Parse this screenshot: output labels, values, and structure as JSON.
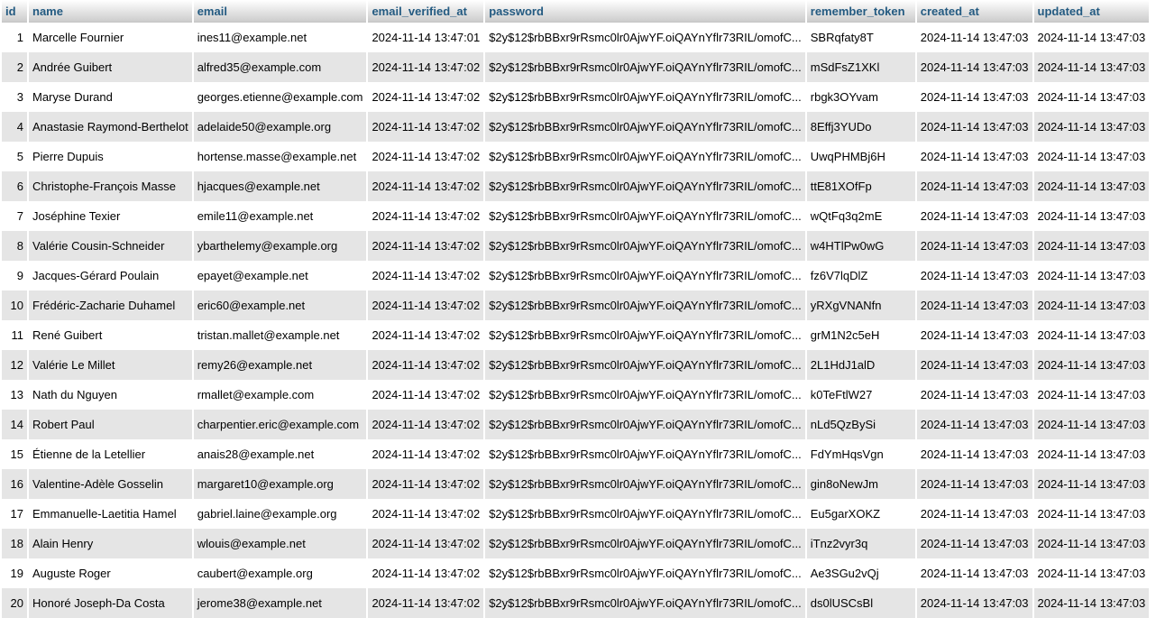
{
  "columns": [
    "id",
    "name",
    "email",
    "email_verified_at",
    "password",
    "remember_token",
    "created_at",
    "updated_at"
  ],
  "rows": [
    [
      "1",
      "Marcelle Fournier",
      "ines11@example.net",
      "2024-11-14 13:47:01",
      "$2y$12$rbBBxr9rRsmc0lr0AjwYF.oiQAYnYflr73RIL/omofC...",
      "SBRqfaty8T",
      "2024-11-14 13:47:03",
      "2024-11-14 13:47:03"
    ],
    [
      "2",
      "Andrée Guibert",
      "alfred35@example.com",
      "2024-11-14 13:47:02",
      "$2y$12$rbBBxr9rRsmc0lr0AjwYF.oiQAYnYflr73RIL/omofC...",
      "mSdFsZ1XKl",
      "2024-11-14 13:47:03",
      "2024-11-14 13:47:03"
    ],
    [
      "3",
      "Maryse Durand",
      "georges.etienne@example.com",
      "2024-11-14 13:47:02",
      "$2y$12$rbBBxr9rRsmc0lr0AjwYF.oiQAYnYflr73RIL/omofC...",
      "rbgk3OYvam",
      "2024-11-14 13:47:03",
      "2024-11-14 13:47:03"
    ],
    [
      "4",
      "Anastasie Raymond-Berthelot",
      "adelaide50@example.org",
      "2024-11-14 13:47:02",
      "$2y$12$rbBBxr9rRsmc0lr0AjwYF.oiQAYnYflr73RIL/omofC...",
      "8Effj3YUDo",
      "2024-11-14 13:47:03",
      "2024-11-14 13:47:03"
    ],
    [
      "5",
      "Pierre Dupuis",
      "hortense.masse@example.net",
      "2024-11-14 13:47:02",
      "$2y$12$rbBBxr9rRsmc0lr0AjwYF.oiQAYnYflr73RIL/omofC...",
      "UwqPHMBj6H",
      "2024-11-14 13:47:03",
      "2024-11-14 13:47:03"
    ],
    [
      "6",
      "Christophe-François Masse",
      "hjacques@example.net",
      "2024-11-14 13:47:02",
      "$2y$12$rbBBxr9rRsmc0lr0AjwYF.oiQAYnYflr73RIL/omofC...",
      "ttE81XOfFp",
      "2024-11-14 13:47:03",
      "2024-11-14 13:47:03"
    ],
    [
      "7",
      "Joséphine Texier",
      "emile11@example.net",
      "2024-11-14 13:47:02",
      "$2y$12$rbBBxr9rRsmc0lr0AjwYF.oiQAYnYflr73RIL/omofC...",
      "wQtFq3q2mE",
      "2024-11-14 13:47:03",
      "2024-11-14 13:47:03"
    ],
    [
      "8",
      "Valérie Cousin-Schneider",
      "ybarthelemy@example.org",
      "2024-11-14 13:47:02",
      "$2y$12$rbBBxr9rRsmc0lr0AjwYF.oiQAYnYflr73RIL/omofC...",
      "w4HTlPw0wG",
      "2024-11-14 13:47:03",
      "2024-11-14 13:47:03"
    ],
    [
      "9",
      "Jacques-Gérard Poulain",
      "epayet@example.net",
      "2024-11-14 13:47:02",
      "$2y$12$rbBBxr9rRsmc0lr0AjwYF.oiQAYnYflr73RIL/omofC...",
      "fz6V7lqDlZ",
      "2024-11-14 13:47:03",
      "2024-11-14 13:47:03"
    ],
    [
      "10",
      "Frédéric-Zacharie Duhamel",
      "eric60@example.net",
      "2024-11-14 13:47:02",
      "$2y$12$rbBBxr9rRsmc0lr0AjwYF.oiQAYnYflr73RIL/omofC...",
      "yRXgVNANfn",
      "2024-11-14 13:47:03",
      "2024-11-14 13:47:03"
    ],
    [
      "11",
      "René Guibert",
      "tristan.mallet@example.net",
      "2024-11-14 13:47:02",
      "$2y$12$rbBBxr9rRsmc0lr0AjwYF.oiQAYnYflr73RIL/omofC...",
      "grM1N2c5eH",
      "2024-11-14 13:47:03",
      "2024-11-14 13:47:03"
    ],
    [
      "12",
      "Valérie Le Millet",
      "remy26@example.net",
      "2024-11-14 13:47:02",
      "$2y$12$rbBBxr9rRsmc0lr0AjwYF.oiQAYnYflr73RIL/omofC...",
      "2L1HdJ1alD",
      "2024-11-14 13:47:03",
      "2024-11-14 13:47:03"
    ],
    [
      "13",
      "Nath du Nguyen",
      "rmallet@example.com",
      "2024-11-14 13:47:02",
      "$2y$12$rbBBxr9rRsmc0lr0AjwYF.oiQAYnYflr73RIL/omofC...",
      "k0TeFtlW27",
      "2024-11-14 13:47:03",
      "2024-11-14 13:47:03"
    ],
    [
      "14",
      "Robert Paul",
      "charpentier.eric@example.com",
      "2024-11-14 13:47:02",
      "$2y$12$rbBBxr9rRsmc0lr0AjwYF.oiQAYnYflr73RIL/omofC...",
      "nLd5QzBySi",
      "2024-11-14 13:47:03",
      "2024-11-14 13:47:03"
    ],
    [
      "15",
      "Étienne de la Letellier",
      "anais28@example.net",
      "2024-11-14 13:47:02",
      "$2y$12$rbBBxr9rRsmc0lr0AjwYF.oiQAYnYflr73RIL/omofC...",
      "FdYmHqsVgn",
      "2024-11-14 13:47:03",
      "2024-11-14 13:47:03"
    ],
    [
      "16",
      "Valentine-Adèle Gosselin",
      "margaret10@example.org",
      "2024-11-14 13:47:02",
      "$2y$12$rbBBxr9rRsmc0lr0AjwYF.oiQAYnYflr73RIL/omofC...",
      "gin8oNewJm",
      "2024-11-14 13:47:03",
      "2024-11-14 13:47:03"
    ],
    [
      "17",
      "Emmanuelle-Laetitia Hamel",
      "gabriel.laine@example.org",
      "2024-11-14 13:47:02",
      "$2y$12$rbBBxr9rRsmc0lr0AjwYF.oiQAYnYflr73RIL/omofC...",
      "Eu5garXOKZ",
      "2024-11-14 13:47:03",
      "2024-11-14 13:47:03"
    ],
    [
      "18",
      "Alain Henry",
      "wlouis@example.net",
      "2024-11-14 13:47:02",
      "$2y$12$rbBBxr9rRsmc0lr0AjwYF.oiQAYnYflr73RIL/omofC...",
      "iTnz2vyr3q",
      "2024-11-14 13:47:03",
      "2024-11-14 13:47:03"
    ],
    [
      "19",
      "Auguste Roger",
      "caubert@example.org",
      "2024-11-14 13:47:02",
      "$2y$12$rbBBxr9rRsmc0lr0AjwYF.oiQAYnYflr73RIL/omofC...",
      "Ae3SGu2vQj",
      "2024-11-14 13:47:03",
      "2024-11-14 13:47:03"
    ],
    [
      "20",
      "Honoré Joseph-Da Costa",
      "jerome38@example.net",
      "2024-11-14 13:47:02",
      "$2y$12$rbBBxr9rRsmc0lr0AjwYF.oiQAYnYflr73RIL/omofC...",
      "ds0lUSCsBl",
      "2024-11-14 13:47:03",
      "2024-11-14 13:47:03"
    ]
  ],
  "colors": {
    "header_text": "#235a81",
    "row_alt": "#e5e5e5",
    "row": "#ffffff"
  }
}
